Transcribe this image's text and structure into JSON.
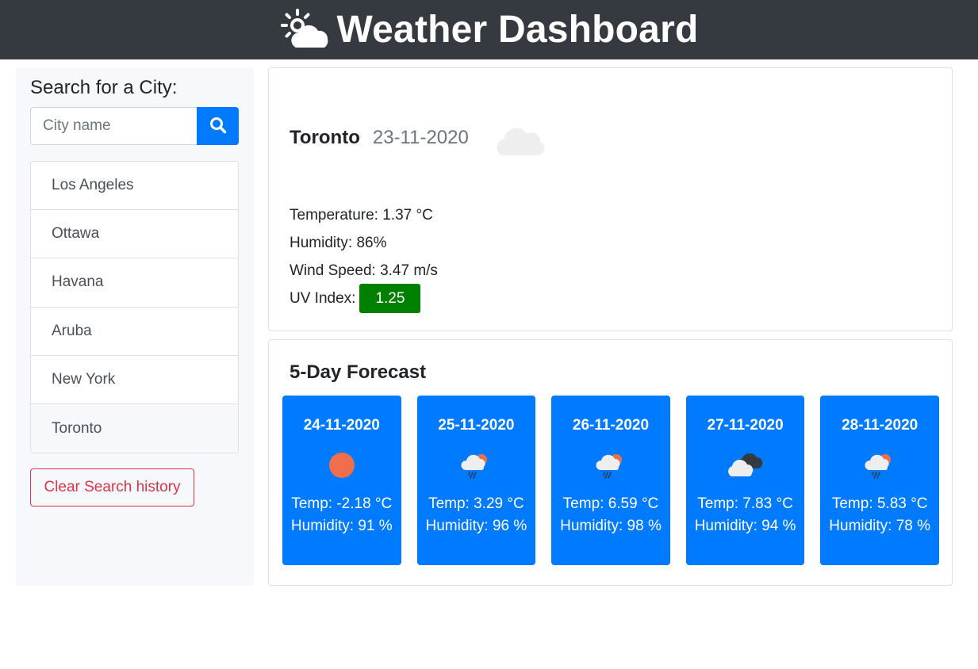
{
  "header": {
    "title": "Weather Dashboard",
    "icon": "sun-cloud-icon"
  },
  "sidebar": {
    "heading": "Search for a City:",
    "search": {
      "placeholder": "City name",
      "value": "",
      "button_icon": "search-icon"
    },
    "history": [
      "Los Angeles",
      "Ottawa",
      "Havana",
      "Aruba",
      "New York",
      "Toronto"
    ],
    "active_city": "Toronto",
    "clear_label": "Clear Search history"
  },
  "current": {
    "city": "Toronto",
    "date": "23-11-2020",
    "icon": "cloud-icon",
    "temperature_label": "Temperature: 1.37 °C",
    "humidity_label": "Humidity: 86%",
    "wind_label": "Wind Speed: 3.47 m/s",
    "uv_label": "UV Index:",
    "uv_value": "1.25",
    "uv_color": "#008000"
  },
  "forecast": {
    "heading": "5-Day Forecast",
    "days": [
      {
        "date": "24-11-2020",
        "icon": "sun-icon",
        "temp": "Temp: -2.18 °C",
        "humidity": "Humidity: 91 %"
      },
      {
        "date": "25-11-2020",
        "icon": "sun-rain-cloud-icon",
        "temp": "Temp: 3.29 °C",
        "humidity": "Humidity: 96 %"
      },
      {
        "date": "26-11-2020",
        "icon": "sun-rain-cloud-icon",
        "temp": "Temp: 6.59 °C",
        "humidity": "Humidity: 98 %"
      },
      {
        "date": "27-11-2020",
        "icon": "broken-clouds-icon",
        "temp": "Temp: 7.83 °C",
        "humidity": "Humidity: 94 %"
      },
      {
        "date": "28-11-2020",
        "icon": "sun-rain-cloud-icon",
        "temp": "Temp: 5.83 °C",
        "humidity": "Humidity: 78 %"
      }
    ],
    "card_color": "#007bff"
  }
}
